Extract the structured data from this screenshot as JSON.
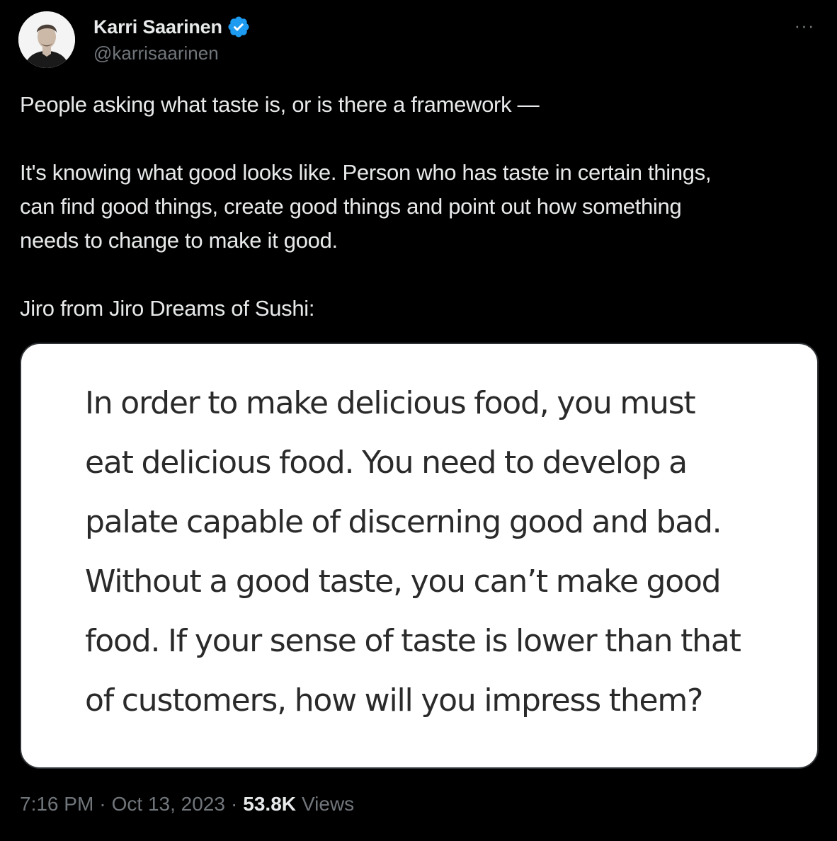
{
  "author": {
    "display_name": "Karri Saarinen",
    "handle": "@karrisaarinen",
    "verified": true
  },
  "more_icon": "···",
  "tweet": {
    "paragraphs": [
      "People asking what taste is, or is there a framework —",
      "It's knowing what good looks like. Person who has taste in certain things,\ncan find good things, create good things and point out how something\nneeds to change to make it good.",
      "Jiro from Jiro Dreams of Sushi:"
    ]
  },
  "media": {
    "quote_lines": [
      "In order to make delicious food, you must",
      "eat delicious food. You need to develop a",
      "palate capable of discerning good and bad.",
      "Without a good taste, you can’t make good",
      "food. If your sense of taste is lower than that",
      "of customers, how will you impress them?"
    ]
  },
  "meta": {
    "time": "7:16 PM",
    "separator": "·",
    "date": "Oct 13, 2023",
    "views_count": "53.8K",
    "views_label": "Views"
  },
  "colors": {
    "background": "#000000",
    "text_primary": "#e7e9ea",
    "text_secondary": "#71767b",
    "verified_blue": "#1d9bf0"
  }
}
